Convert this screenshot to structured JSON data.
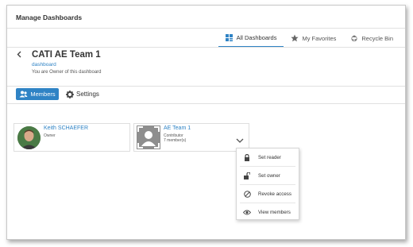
{
  "window": {
    "title": "Manage Dashboards"
  },
  "tabs": [
    {
      "label": "All Dashboards",
      "icon": "grid-icon",
      "active": true
    },
    {
      "label": "My Favorites",
      "icon": "star-icon",
      "active": false
    },
    {
      "label": "Recycle Bin",
      "icon": "recycle-icon",
      "active": false
    }
  ],
  "header": {
    "title": "CATI AE Team 1",
    "link": "dashboard",
    "ownership": "You are Owner of this dashboard"
  },
  "subtabs": {
    "members_label": "Members",
    "settings_label": "Settings"
  },
  "members": [
    {
      "name": "Keith SCHAEFER",
      "role": "Owner",
      "count": ""
    },
    {
      "name": "AE Team 1",
      "role": "Contributor",
      "count": "7 member(s)"
    }
  ],
  "menu": {
    "items": [
      {
        "label": "Set reader",
        "icon": "lock-icon"
      },
      {
        "label": "Set owner",
        "icon": "unlock-icon"
      },
      {
        "label": "Revoke access",
        "icon": "ban-icon"
      },
      {
        "label": "View members",
        "icon": "eye-icon"
      }
    ]
  },
  "colors": {
    "accent": "#2f83c5",
    "text": "#333333",
    "border": "#e1e1e1"
  }
}
